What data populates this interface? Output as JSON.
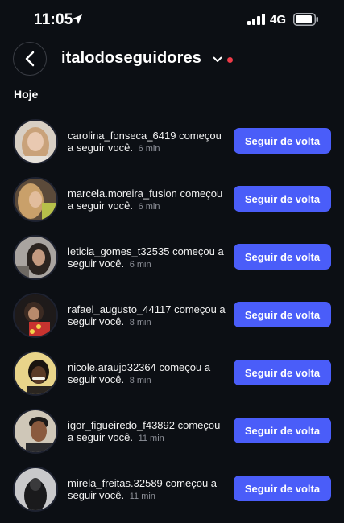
{
  "status_bar": {
    "time": "11:05",
    "network": "4G"
  },
  "header": {
    "title": "italodoseguidores"
  },
  "section": {
    "title": "Hoje"
  },
  "notifications": [
    {
      "username": "carolina_fonseca_6419",
      "message": "começou a seguir você.",
      "time": "6 min",
      "button": "Seguir de volta"
    },
    {
      "username": "marcela.moreira_fusion",
      "message": "começou a seguir você.",
      "time": "6 min",
      "button": "Seguir de volta"
    },
    {
      "username": "leticia_gomes_t32535",
      "message": "começou a seguir você.",
      "time": "6 min",
      "button": "Seguir de volta"
    },
    {
      "username": "rafael_augusto_44117",
      "message": "começou a seguir você.",
      "time": "8 min",
      "button": "Seguir de volta"
    },
    {
      "username": "nicole.araujo32364",
      "message": "começou a seguir você.",
      "time": "8 min",
      "button": "Seguir de volta"
    },
    {
      "username": "igor_figueiredo_f43892",
      "message": "começou a seguir você.",
      "time": "11 min",
      "button": "Seguir de volta"
    },
    {
      "username": "mirela_freitas.32589",
      "message": "começou a seguir você.",
      "time": "11 min",
      "button": "Seguir de volta"
    }
  ],
  "colors": {
    "background": "#0c0f14",
    "accent": "#4a5df9",
    "notification_dot": "#ef3b48",
    "muted_text": "#8e9199"
  },
  "icons": {
    "back": "chevron-left-icon",
    "dropdown": "chevron-down-icon",
    "location": "location-arrow-icon",
    "signal": "signal-bars-icon",
    "battery": "battery-icon"
  }
}
